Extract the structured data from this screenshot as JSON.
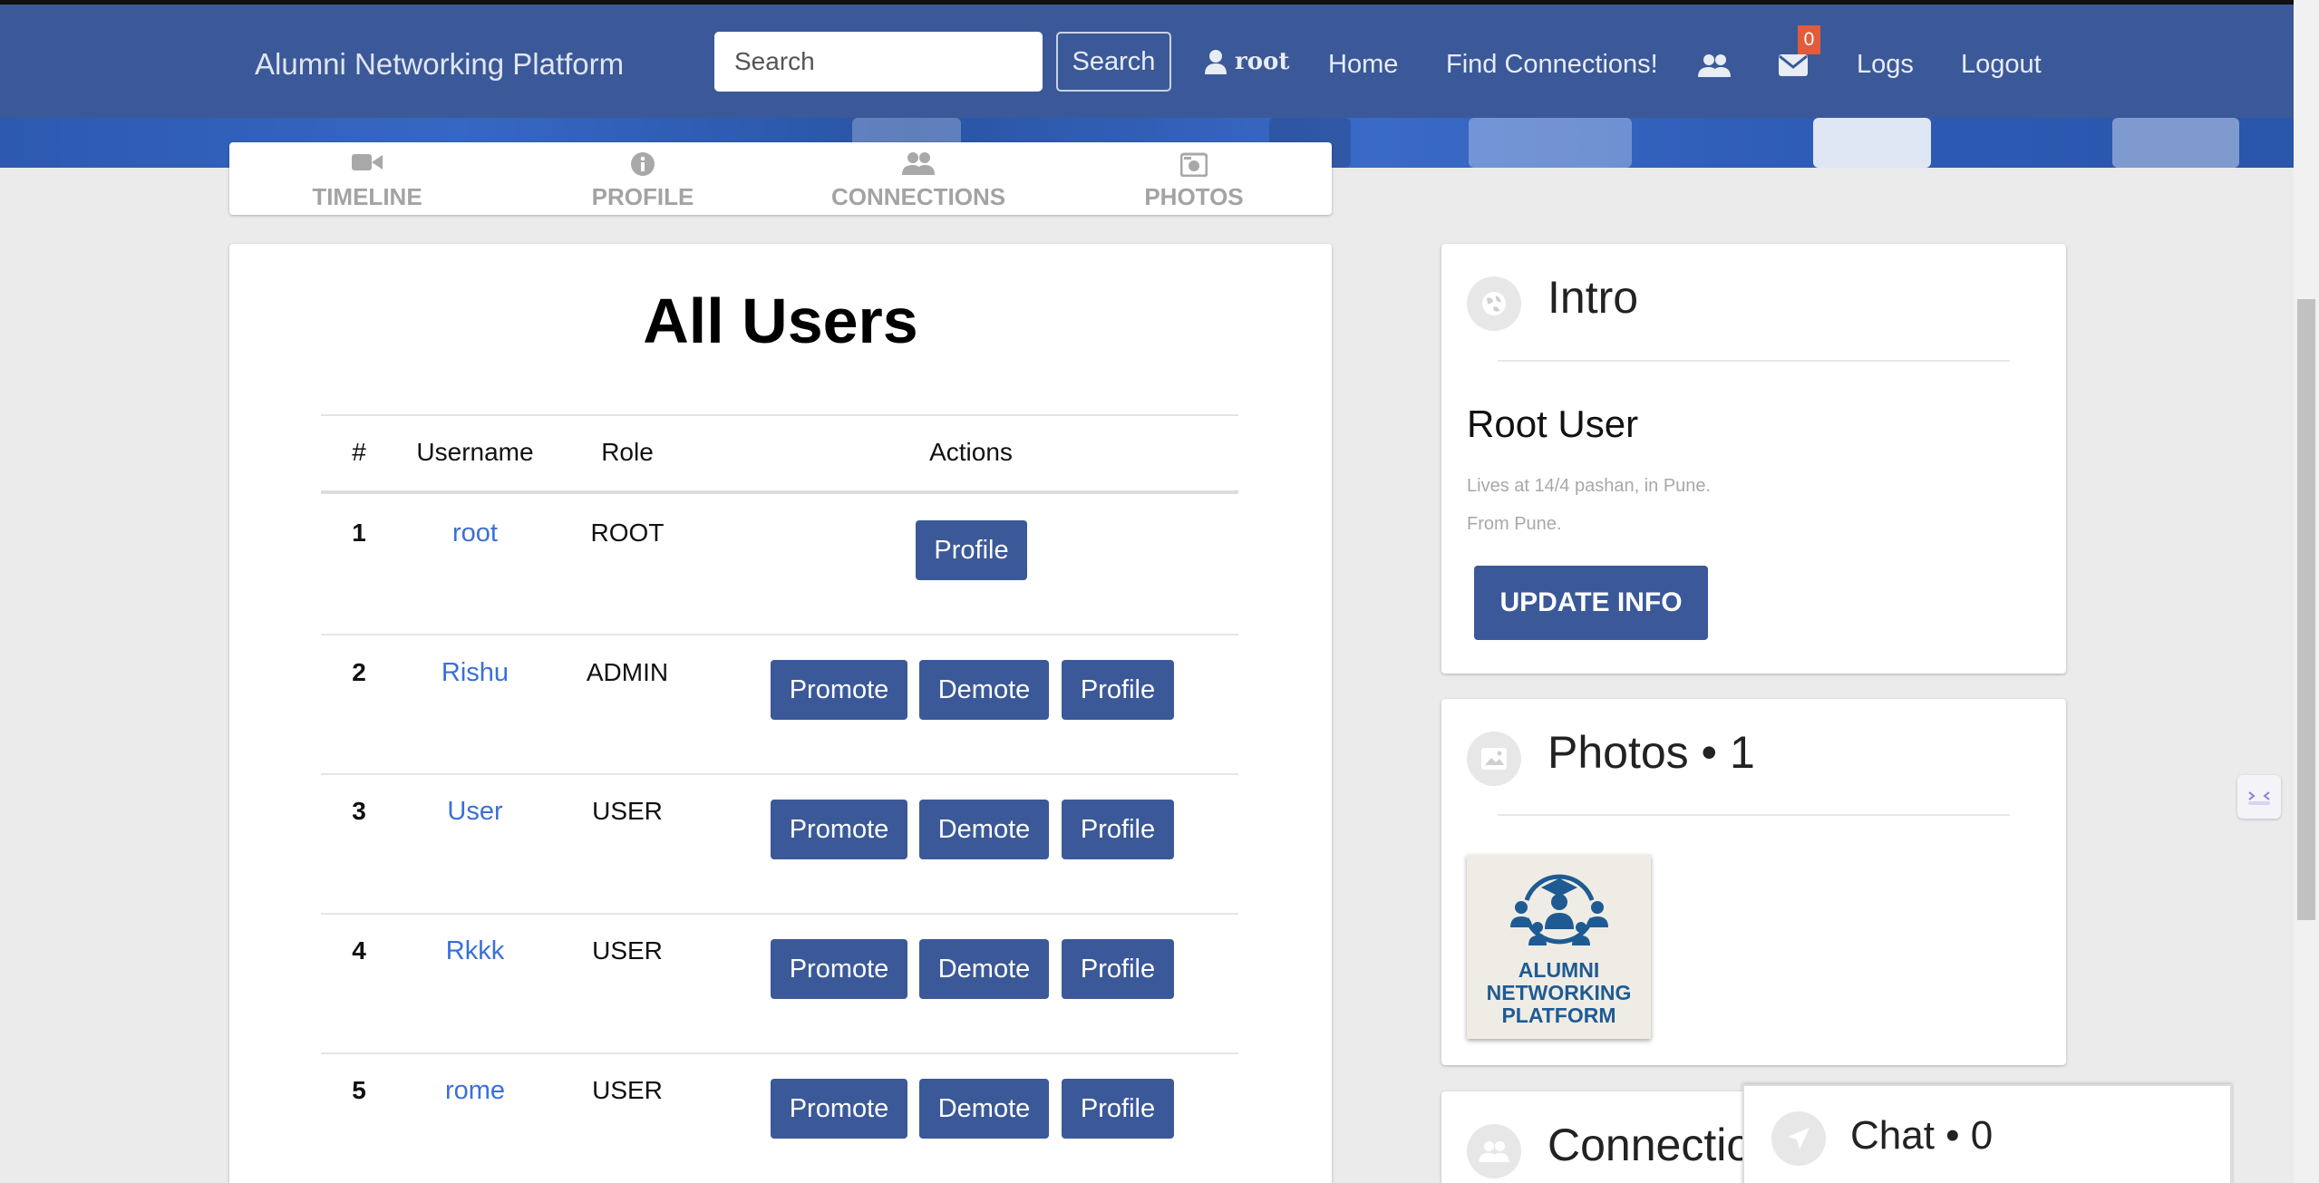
{
  "navbar": {
    "brand": "Alumni Networking Platform",
    "search_placeholder": "Search",
    "search_button": "Search",
    "user": "root",
    "home": "Home",
    "find_connections": "Find Connections!",
    "notification_count": "0",
    "logs": "Logs",
    "logout": "Logout"
  },
  "tabs": [
    {
      "label": "TIMELINE",
      "icon": "video-camera-icon"
    },
    {
      "label": "PROFILE",
      "icon": "info-circle-icon"
    },
    {
      "label": "CONNECTIONS",
      "icon": "users-icon"
    },
    {
      "label": "PHOTOS",
      "icon": "camera-icon"
    }
  ],
  "users_table": {
    "title": "All Users",
    "headers": [
      "#",
      "Username",
      "Role",
      "Actions"
    ],
    "rows": [
      {
        "num": "1",
        "username": "root",
        "role": "ROOT",
        "actions": [
          "Profile"
        ]
      },
      {
        "num": "2",
        "username": "Rishu",
        "role": "ADMIN",
        "actions": [
          "Promote",
          "Demote",
          "Profile"
        ]
      },
      {
        "num": "3",
        "username": "User",
        "role": "USER",
        "actions": [
          "Promote",
          "Demote",
          "Profile"
        ]
      },
      {
        "num": "4",
        "username": "Rkkk",
        "role": "USER",
        "actions": [
          "Promote",
          "Demote",
          "Profile"
        ]
      },
      {
        "num": "5",
        "username": "rome",
        "role": "USER",
        "actions": [
          "Promote",
          "Demote",
          "Profile"
        ]
      }
    ]
  },
  "intro": {
    "title": "Intro",
    "name": "Root User",
    "lives": "Lives at 14/4 pashan, in Pune.",
    "from": "From Pune.",
    "update_button": "UPDATE INFO"
  },
  "photos": {
    "title": "Photos • 1",
    "logo_text": [
      "ALUMNI",
      "NETWORKING",
      "PLATFORM"
    ]
  },
  "connections": {
    "title": "Connections"
  },
  "chat": {
    "title": "Chat • 0"
  },
  "colors": {
    "primary": "#3b5998",
    "link": "#3a6fd8",
    "badge": "#e35b3a",
    "page_bg": "#ebebeb"
  }
}
